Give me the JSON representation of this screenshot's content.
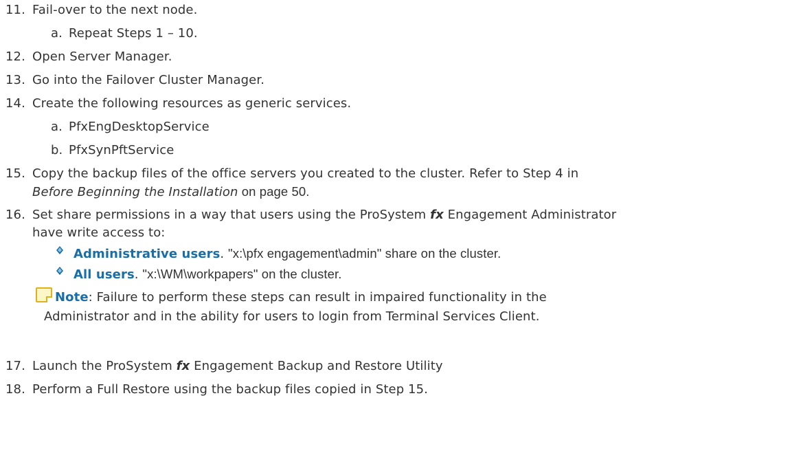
{
  "steps": {
    "s11": {
      "num": "11.",
      "text": "Fail-over to the next node."
    },
    "s11a": {
      "num": "a.",
      "text": "Repeat Steps 1 – 10."
    },
    "s12": {
      "num": "12.",
      "text": "Open Server Manager."
    },
    "s13": {
      "num": "13.",
      "text": "Go into the Failover Cluster Manager."
    },
    "s14": {
      "num": "14.",
      "text": "Create the following resources as generic services."
    },
    "s14a": {
      "num": "a.",
      "text": "PfxEngDesktopService"
    },
    "s14b": {
      "num": "b.",
      "text": "PfxSynPftService"
    },
    "s15": {
      "num": "15.",
      "line1": "Copy the backup files of the office servers you created to the cluster. Refer to Step 4 in",
      "line2_link": "Before Beginning the Installation",
      "line2_rest": " on page 50."
    },
    "s16": {
      "num": "16.",
      "line1_pre": "Set share permissions in a way that users using the ProSystem ",
      "line1_fx": "fx",
      "line1_post": " Engagement Administrator",
      "line2": "have write access to:",
      "bullet1_label": "Administrative users",
      "bullet1_sep": ". ",
      "bullet1_text": "\"x:\\pfx engagement\\admin\" share on the cluster.",
      "bullet2_label": "All users",
      "bullet2_sep": ". ",
      "bullet2_text": "\"x:\\WM\\workpapers\" on the cluster."
    },
    "note": {
      "label": "Note",
      "line1": ": Failure to perform these steps can result in impaired functionality in the",
      "line2": "Administrator and in the ability for users to login from Terminal Services Client."
    },
    "s17": {
      "num": "17.",
      "pre": "Launch the ProSystem ",
      "fx": "fx",
      "post": " Engagement Backup and Restore Utility"
    },
    "s18": {
      "num": "18.",
      "text": "Perform a Full Restore using the backup files copied in Step 15."
    }
  },
  "colors": {
    "text": "#333333",
    "accent": "#1a6ea8",
    "note_border": "#e0b21a",
    "note_fill": "#fdf7c8"
  }
}
